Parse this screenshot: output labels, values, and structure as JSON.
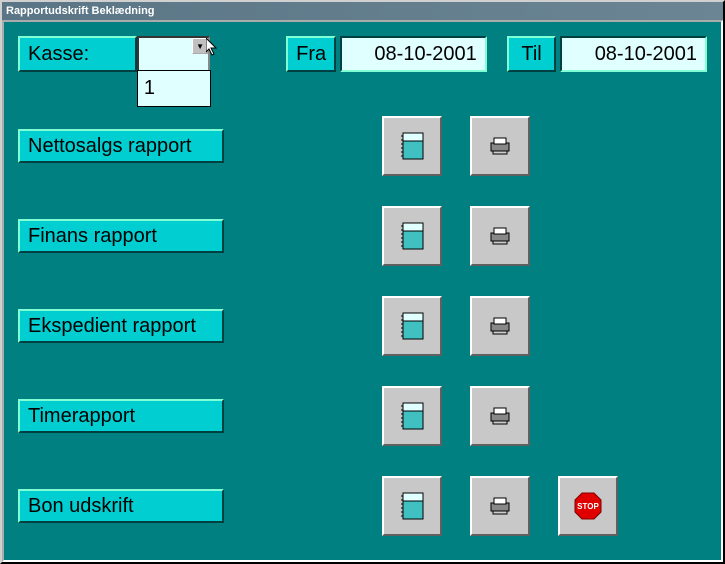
{
  "title": "Rapportudskrift Beklædning",
  "kasse": {
    "label": "Kasse:",
    "value": "",
    "options": [
      "1"
    ]
  },
  "fra": {
    "label": "Fra",
    "value": "08-10-2001"
  },
  "til": {
    "label": "Til",
    "value": "08-10-2001"
  },
  "reports": [
    {
      "label": "Nettosalgs rapport"
    },
    {
      "label": "Finans rapport"
    },
    {
      "label": "Ekspedient rapport"
    },
    {
      "label": "Timerapport"
    },
    {
      "label": "Bon udskrift"
    }
  ],
  "icons": {
    "view": "notebook-icon",
    "print": "printer-icon",
    "stop": "stop-icon"
  }
}
